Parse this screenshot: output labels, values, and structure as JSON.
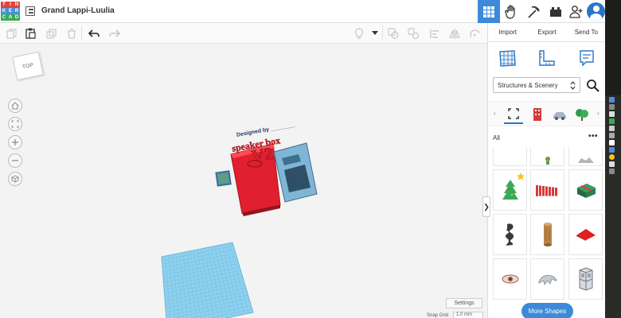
{
  "app": {
    "logo_letters": [
      "T",
      "I",
      "N",
      "K",
      "E",
      "R",
      "C",
      "A",
      "D"
    ],
    "logo_colors": [
      "#e2433b",
      "#e2433b",
      "#e2433b",
      "#4a90d9",
      "#4a90d9",
      "#4a90d9",
      "#3aaa58",
      "#3aaa58",
      "#3aaa58"
    ],
    "title": "Grand Lappi-Luulia"
  },
  "topbar": {
    "view_buttons": [
      {
        "icon": "grid-view-icon",
        "active": true
      },
      {
        "icon": "glove-icon",
        "active": false
      },
      {
        "icon": "pickaxe-icon",
        "active": false
      },
      {
        "icon": "bricks-icon",
        "active": false
      },
      {
        "icon": "add-user-icon",
        "active": false
      }
    ],
    "avatar": "avatar-icon"
  },
  "toolbar": {
    "buttons": [
      "copy-icon",
      "paste-icon",
      "duplicate-icon",
      "delete-icon",
      "undo-icon",
      "redo-icon"
    ],
    "right_buttons": [
      "light-bulb-icon",
      "dropdown-arrow-icon",
      "group-icon",
      "ungroup-icon",
      "align-icon",
      "mirror-icon",
      "workplane-icon"
    ]
  },
  "workplane": {
    "viewcube_label": "TOP",
    "nav_buttons": [
      "home-icon",
      "fit-icon",
      "zoom-in-icon",
      "zoom-out-icon",
      "perspective-icon"
    ],
    "settings_label": "Settings",
    "snap_grid_label": "Snap Grid",
    "snap_grid_value": "1.0 mm",
    "model_text": {
      "credit": "Designed by ________",
      "name": "speaker box",
      "version": "V2"
    }
  },
  "right_panel": {
    "tabs": [
      "Import",
      "Export",
      "Send To"
    ],
    "panel_icons": [
      "workplane-grid-icon",
      "ruler-icon",
      "notes-icon"
    ],
    "category": "Structures & Scenery",
    "search_icon": "search-icon",
    "category_thumbs": [
      "selection-icon",
      "red-building-icon",
      "gray-vehicle-icon",
      "green-tree-icon"
    ],
    "all_label": "All",
    "more_shapes_label": "More Shapes",
    "shapes": [
      {
        "name": "gray-shape-icon",
        "color": "#bbbbbb"
      },
      {
        "name": "figure-icon",
        "color": "#9a8a3a"
      },
      {
        "name": "gray-rock-icon",
        "color": "#b5b5b5"
      },
      {
        "name": "christmas-tree-icon",
        "color": "#3aaa58"
      },
      {
        "name": "red-fence-icon",
        "color": "#d63b3b"
      },
      {
        "name": "green-gift-icon",
        "color": "#2e7d4f"
      },
      {
        "name": "dark-figure-icon",
        "color": "#3a3a3a"
      },
      {
        "name": "wooden-log-icon",
        "color": "#b8864a"
      },
      {
        "name": "red-tile-icon",
        "color": "#e02020"
      },
      {
        "name": "eye-icon",
        "color": "#a35b45"
      },
      {
        "name": "dragon-icon",
        "color": "#9ea3a8"
      },
      {
        "name": "crate-stack-icon",
        "color": "#9ea3a8"
      }
    ]
  },
  "colors": {
    "accent": "#3c8ad8",
    "model_red": "#e0202f",
    "model_blue": "#7fb6d6",
    "workplane_blue": "#8fd1ee"
  }
}
